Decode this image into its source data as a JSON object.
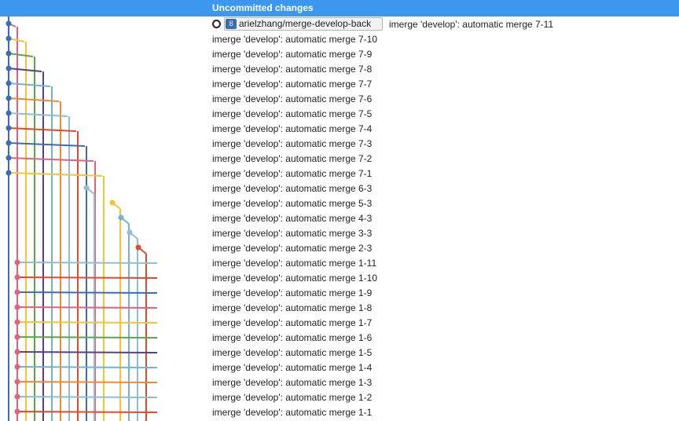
{
  "header": {
    "title": "Uncommitted changes"
  },
  "head_branch": {
    "name": "arielzhang/merge-develop-back",
    "icon": "branch-icon"
  },
  "commits": [
    "imerge 'develop': automatic merge 7-11",
    "imerge 'develop': automatic merge 7-10",
    "imerge 'develop': automatic merge 7-9",
    "imerge 'develop': automatic merge 7-8",
    "imerge 'develop': automatic merge 7-7",
    "imerge 'develop': automatic merge 7-6",
    "imerge 'develop': automatic merge 7-5",
    "imerge 'develop': automatic merge 7-4",
    "imerge 'develop': automatic merge 7-3",
    "imerge 'develop': automatic merge 7-2",
    "imerge 'develop': automatic merge 7-1",
    "imerge 'develop': automatic merge 6-3",
    "imerge 'develop': automatic merge 5-3",
    "imerge 'develop': automatic merge 4-3",
    "imerge 'develop': automatic merge 3-3",
    "imerge 'develop': automatic merge 2-3",
    "imerge 'develop': automatic merge 1-11",
    "imerge 'develop': automatic merge 1-10",
    "imerge 'develop': automatic merge 1-9",
    "imerge 'develop': automatic merge 1-8",
    "imerge 'develop': automatic merge 1-7",
    "imerge 'develop': automatic merge 1-6",
    "imerge 'develop': automatic merge 1-5",
    "imerge 'develop': automatic merge 1-4",
    "imerge 'develop': automatic merge 1-3",
    "imerge 'develop': automatic merge 1-2",
    "imerge 'develop': automatic merge 1-1"
  ],
  "colors": {
    "header_bg": "#3c98ef",
    "lanes": [
      "#3a6db5",
      "#e3617b",
      "#f7c334",
      "#58a84a",
      "#5b3d8a",
      "#6fb3d8",
      "#f08a30",
      "#8cbfd0",
      "#e44a2a"
    ]
  }
}
